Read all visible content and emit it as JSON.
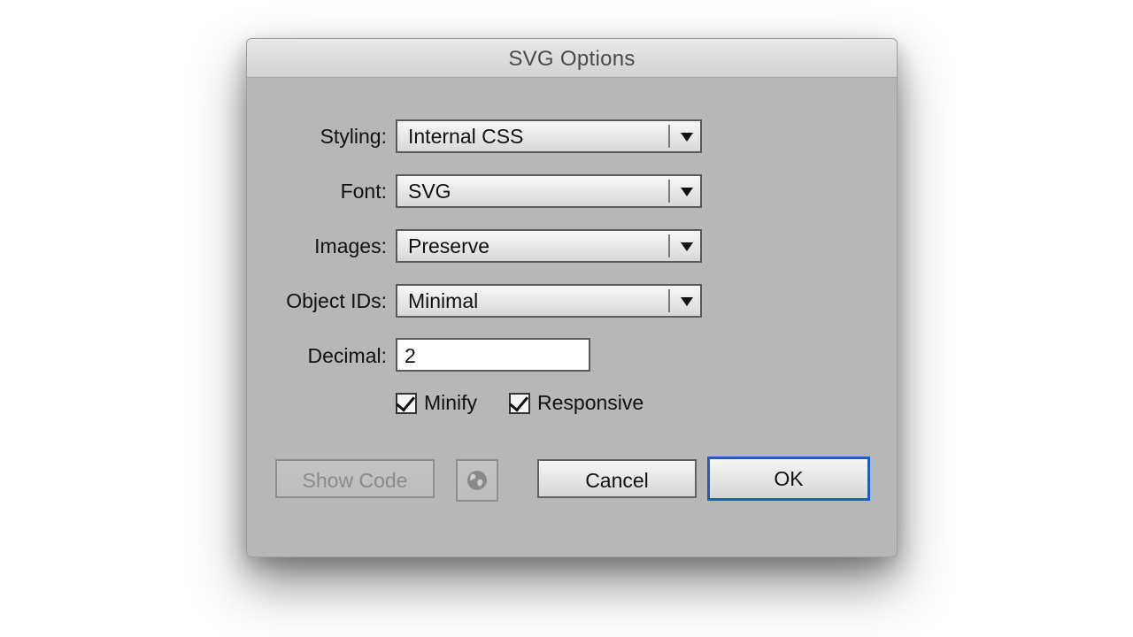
{
  "dialog": {
    "title": "SVG Options"
  },
  "fields": {
    "styling": {
      "label": "Styling:",
      "value": "Internal CSS"
    },
    "font": {
      "label": "Font:",
      "value": "SVG"
    },
    "images": {
      "label": "Images:",
      "value": "Preserve"
    },
    "object_ids": {
      "label": "Object IDs:",
      "value": "Minimal"
    },
    "decimal": {
      "label": "Decimal:",
      "value": "2"
    }
  },
  "checkboxes": {
    "minify": {
      "label": "Minify",
      "checked": true
    },
    "responsive": {
      "label": "Responsive",
      "checked": true
    }
  },
  "buttons": {
    "show_code": "Show Code",
    "web_preview_icon": "globe-icon",
    "cancel": "Cancel",
    "ok": "OK"
  },
  "colors": {
    "dialog_bg": "#b7b7b7",
    "default_button_border": "#1f5dbe"
  }
}
